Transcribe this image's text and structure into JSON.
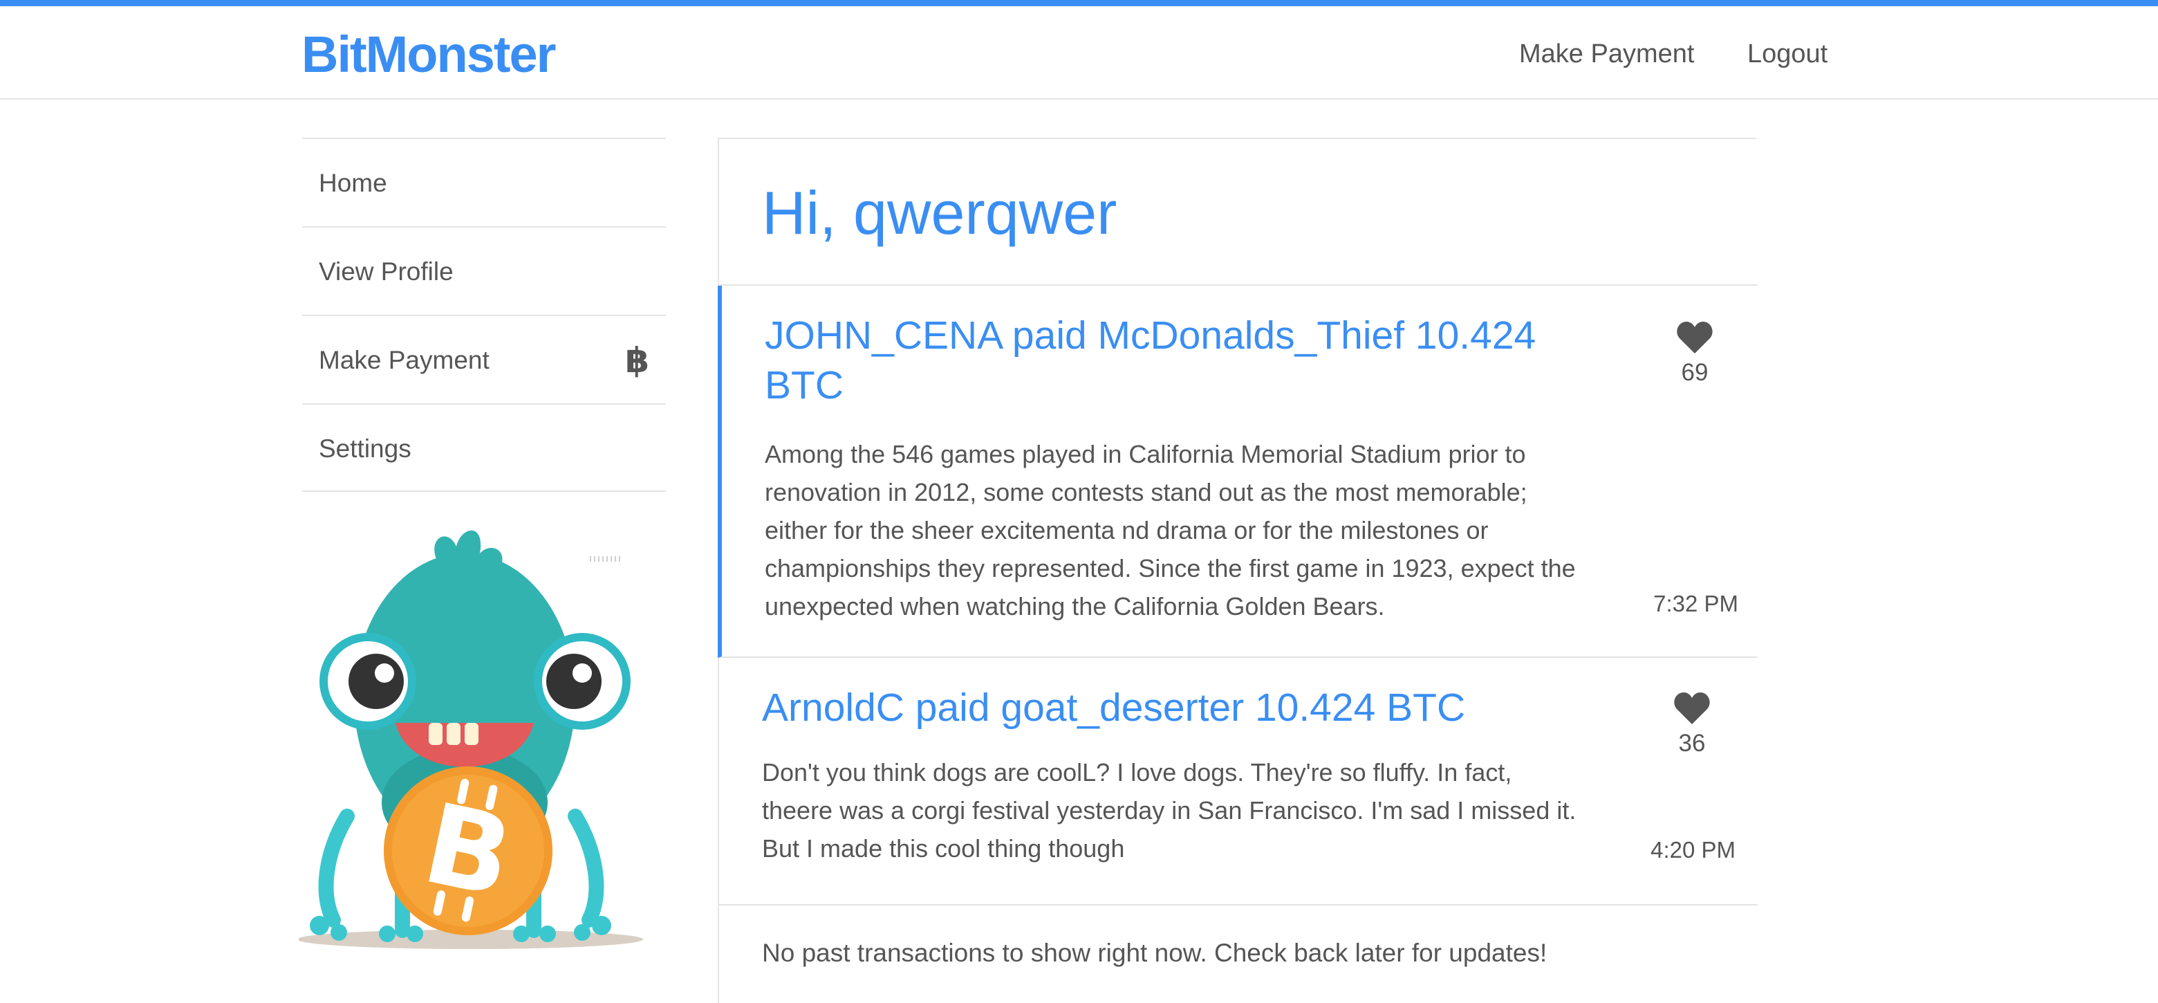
{
  "header": {
    "brand": "BitMonster",
    "nav": {
      "make_payment": "Make Payment",
      "logout": "Logout"
    }
  },
  "sidebar": {
    "items": [
      {
        "label": "Home"
      },
      {
        "label": "View Profile"
      },
      {
        "label": "Make Payment",
        "icon": "bitcoin-icon",
        "glyph": "฿"
      },
      {
        "label": "Settings"
      }
    ]
  },
  "main": {
    "greeting": "Hi, qwerqwer",
    "transactions": [
      {
        "title": "JOHN_CENA paid McDonalds_Thief 10.424 BTC",
        "message": "Among the 546 games played in California Memorial Stadium prior to renovation in 2012, some contests stand out as the most memorable; either for the sheer excitementa nd drama or for the milestones or championships they represented. Since the first game in 1923, expect the unexpected when watching the California Golden Bears.",
        "likes": "69",
        "time": "7:32 PM"
      },
      {
        "title": "ArnoldC paid goat_deserter 10.424 BTC",
        "message": "Don't you think dogs are coolL? I love dogs. They're so fluffy. In fact, theere was a corgi festival yesterday in San Francisco. I'm sad I missed it. But I made this cool thing though",
        "likes": "36",
        "time": "4:20 PM"
      }
    ],
    "empty_notice": "No past transactions to show right now. Check back later for updates!"
  },
  "colors": {
    "accent": "#3a8ef3",
    "text": "#555555",
    "divider": "#e4e4e4",
    "monster_body": "#33b3b0",
    "coin": "#f39a2e"
  }
}
